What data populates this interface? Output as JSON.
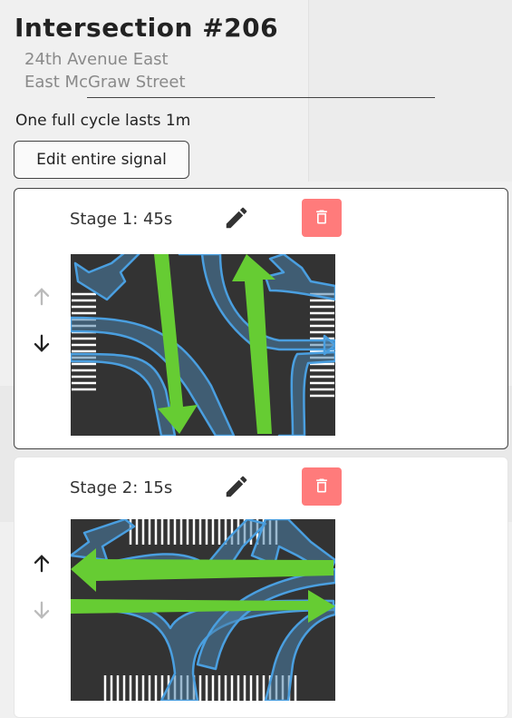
{
  "header": {
    "title": "Intersection #206",
    "streets": [
      "24th Avenue East",
      "East McGraw Street"
    ],
    "cycle_text": "One full cycle lasts 1m",
    "edit_button": "Edit entire signal"
  },
  "stages": [
    {
      "label": "Stage 1: 45s",
      "move_up_enabled": false,
      "move_down_enabled": true
    },
    {
      "label": "Stage 2: 15s",
      "move_up_enabled": true,
      "move_down_enabled": false
    }
  ],
  "colors": {
    "protected_turn": "#66cc33",
    "permitted_turn": "#4a9fe0",
    "delete_button": "#ff7b7b",
    "road": "#333333",
    "disabled_arrow": "#bbbbbb"
  },
  "icons": [
    "pencil-icon",
    "trash-icon",
    "arrow-up-icon",
    "arrow-down-icon"
  ]
}
